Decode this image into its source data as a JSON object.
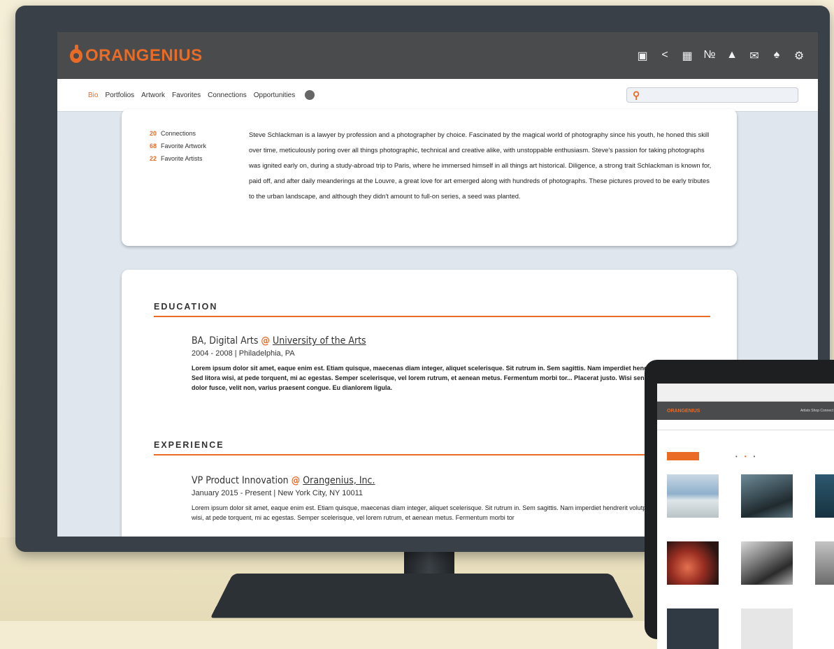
{
  "app": {
    "brand": "ORANGENIUS",
    "accent": "#e96b25",
    "header_bg": "#4a4b4d"
  },
  "toolbar_icons": [
    "image-icon",
    "share-icon",
    "portfolio-icon",
    "linkedin-icon",
    "education-icon",
    "mail-icon",
    "bell-icon",
    "gear-icon"
  ],
  "nav": {
    "tabs": [
      "Bio",
      "Portfolios",
      "Artwork",
      "Favorites",
      "Connections",
      "Opportunities"
    ],
    "active": "Bio"
  },
  "stats": [
    {
      "count": "20",
      "label": "Connections"
    },
    {
      "count": "68",
      "label": "Favorite Artwork"
    },
    {
      "count": "22",
      "label": "Favorite Artists"
    }
  ],
  "bio": {
    "text": "Steve Schlackman is a lawyer by profession and a photographer by choice. Fascinated by the magical world of photography since his youth, he honed this skill over time, meticulously poring over all things photographic, technical and creative alike, with unstoppable enthusiasm. Steve's passion for taking photographs was ignited early on, during a study-abroad trip to Paris, where he immersed himself in all things art historical. Diligence, a strong trait Schlackman is known for, paid off, and after daily meanderings at the Louvre, a great love for art emerged along with hundreds of photographs. These pictures proved to be early tributes to the urban landscape, and although they didn't amount to full-on series, a seed was planted."
  },
  "education": {
    "heading": "EDUCATION",
    "degree": "BA, Digital Arts",
    "at": "@",
    "school": "University of the Arts",
    "dates": "2004 - 2008",
    "separator": "|",
    "location": "Philadelphia, PA",
    "body": "Lorem ipsum dolor sit amet, eaque enim est. Etiam quisque, maecenas diam integer, aliquet scelerisque. Sit rutrum in. Sem sagittis. Nam imperdiet hendrerit volutpat. Sed litora wisi, at pede torquent, mi ac egestas. Semper scelerisque, vel lorem rutrum, et aenean metus. Fermentum morbi tor... Placerat justo. Wisi senectus. Libero dolor fusce, velit non, varius praesent congue. Eu dianlorem ligula."
  },
  "experience": {
    "heading": "EXPERIENCE",
    "title": "VP Product Innovation",
    "at": "@",
    "company": "Orangenius, Inc.",
    "dates": "January 2015 - Present",
    "separator": "|",
    "location": "New York City, NY 10011",
    "body": "Lorem ipsum dolor sit amet, eaque enim est. Etiam quisque, maecenas diam integer, aliquet scelerisque. Sit rutrum in. Sem sagittis. Nam imperdiet hendrerit volutpat. Sed litora wisi, at pede torquent, mi ac egestas. Semper scelerisque, vel lorem rutrum, et aenean metus. Fermentum morbi tor"
  },
  "tablet": {
    "brand": "ORANGENIUS",
    "links": "Artists  Shop  Connect"
  }
}
